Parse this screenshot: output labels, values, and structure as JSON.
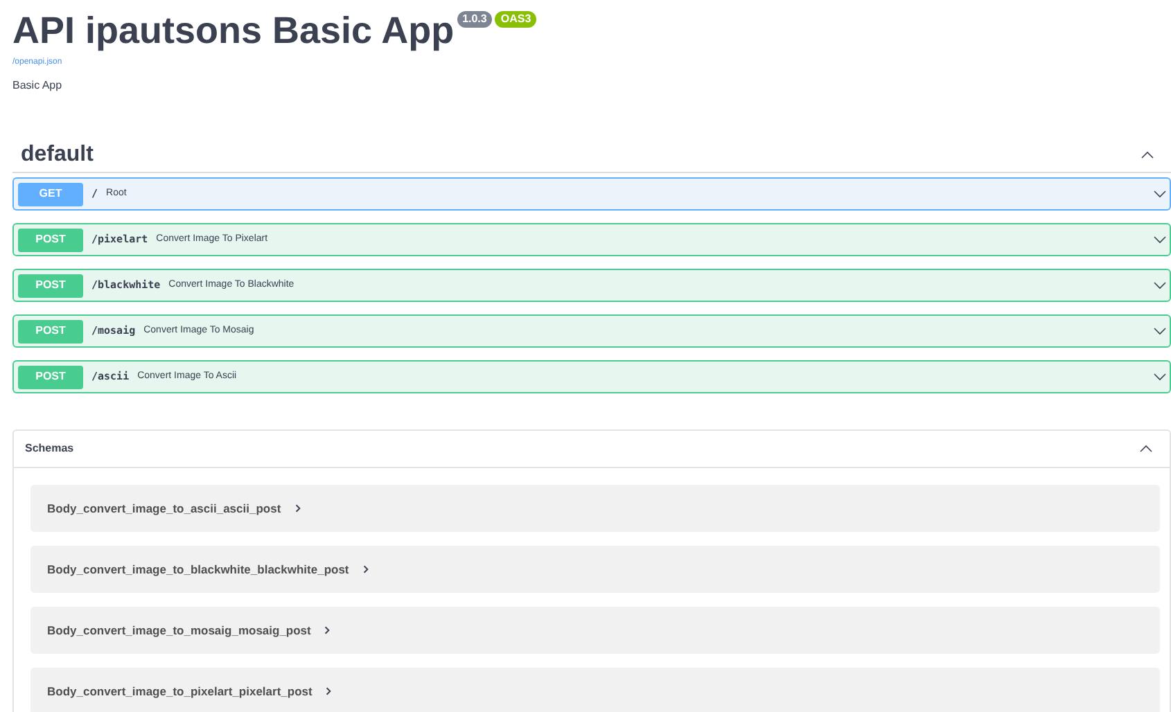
{
  "title": "API ipautsons Basic App",
  "version": "1.0.3",
  "spec_badge": "OAS3",
  "spec_link": "/openapi.json",
  "description": "Basic App",
  "section": {
    "title": "default",
    "expanded": true,
    "operations": [
      {
        "kind": "get",
        "method": "GET",
        "path": "/",
        "summary": "Root",
        "expanded": false
      },
      {
        "kind": "post",
        "method": "POST",
        "path": "/pixelart",
        "summary": "Convert Image To Pixelart",
        "expanded": false
      },
      {
        "kind": "post",
        "method": "POST",
        "path": "/blackwhite",
        "summary": "Convert Image To Blackwhite",
        "expanded": false
      },
      {
        "kind": "post",
        "method": "POST",
        "path": "/mosaig",
        "summary": "Convert Image To Mosaig",
        "expanded": false
      },
      {
        "kind": "post",
        "method": "POST",
        "path": "/ascii",
        "summary": "Convert Image To Ascii",
        "expanded": false
      }
    ]
  },
  "schemas": {
    "title": "Schemas",
    "expanded": true,
    "items": [
      {
        "name": "Body_convert_image_to_ascii_ascii_post",
        "expanded": false
      },
      {
        "name": "Body_convert_image_to_blackwhite_blackwhite_post",
        "expanded": false
      },
      {
        "name": "Body_convert_image_to_mosaig_mosaig_post",
        "expanded": false
      },
      {
        "name": "Body_convert_image_to_pixelart_pixelart_post",
        "expanded": false
      }
    ]
  }
}
